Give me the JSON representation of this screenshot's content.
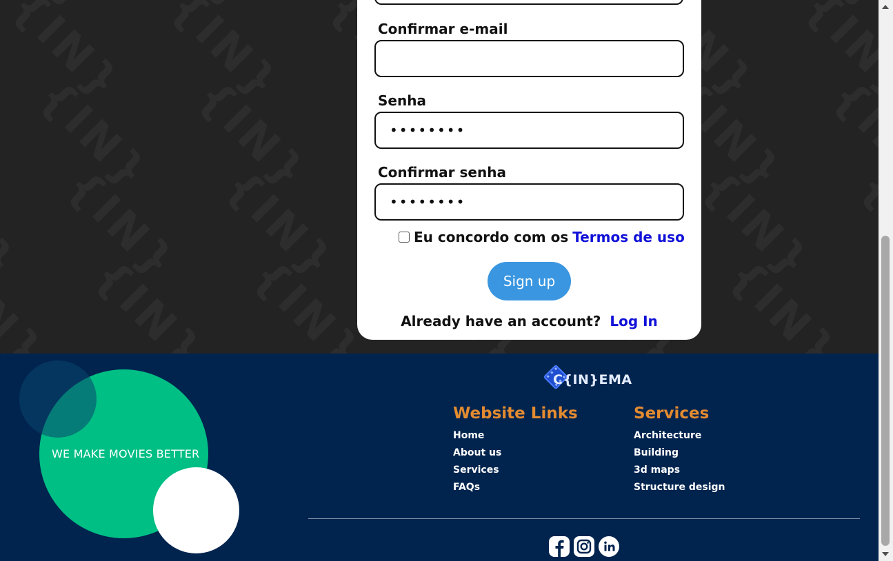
{
  "form": {
    "confirm_email_label": "Confirmar e-mail",
    "confirm_email_value": "",
    "password_label": "Senha",
    "password_value": "••••••••",
    "confirm_password_label": "Confirmar senha",
    "confirm_password_value": "••••••••",
    "agree_text": "Eu concordo com os",
    "terms_link": "Termos de uso",
    "signup_label": "Sign up",
    "login_prompt": "Already have an account?",
    "login_link": "Log In"
  },
  "footer": {
    "tagline": "WE MAKE MOVIES BETTER",
    "logo_text": "C{IN}EMA",
    "website_links_title": "Website Links",
    "website_links": [
      "Home",
      "About us",
      "Services",
      "FAQs"
    ],
    "services_title": "Services",
    "services": [
      "Architecture",
      "Building",
      "3d maps",
      "Structure design"
    ],
    "social_icons": [
      "facebook-icon",
      "instagram-icon",
      "linkedin-icon"
    ]
  },
  "pattern_text": "{IN}",
  "colors": {
    "footer_bg": "#01244f",
    "accent_orange": "#e38b30",
    "green_circle": "#00bf84",
    "signup_button": "#3a96e0",
    "link_blue": "#1010d8"
  }
}
